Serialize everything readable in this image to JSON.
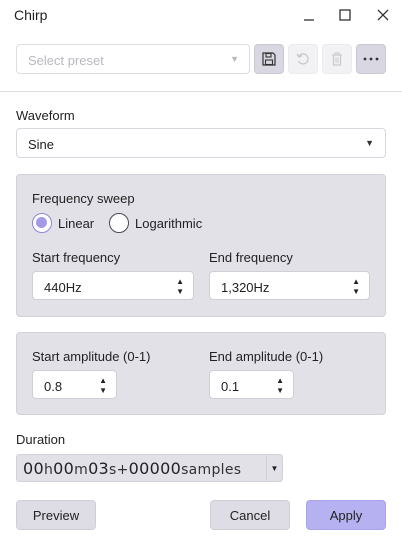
{
  "window": {
    "title": "Chirp"
  },
  "preset": {
    "placeholder": "Select preset"
  },
  "waveform": {
    "label": "Waveform",
    "value": "Sine"
  },
  "sweep": {
    "label": "Frequency sweep",
    "options": [
      "Linear",
      "Logarithmic"
    ],
    "selected": "Linear",
    "start_label": "Start frequency",
    "start_value": "440Hz",
    "end_label": "End frequency",
    "end_value": "1,320Hz"
  },
  "amplitude": {
    "start_label": "Start amplitude (0-1)",
    "start_value": "0.8",
    "end_label": "End amplitude (0-1)",
    "end_value": "0.1"
  },
  "duration": {
    "label": "Duration",
    "hours": "00",
    "hours_unit": "h",
    "minutes": "00",
    "minutes_unit": "m",
    "seconds": "03",
    "seconds_unit": "s+",
    "samples": "00000",
    "samples_unit": "samples"
  },
  "buttons": {
    "preview": "Preview",
    "cancel": "Cancel",
    "apply": "Apply"
  },
  "colors": {
    "accent": "#b6b1f0",
    "panel": "#e2e1e8"
  },
  "icons": {
    "minimize": "minimize-icon",
    "maximize": "maximize-icon",
    "close": "close-icon",
    "save": "save-icon",
    "undo": "undo-icon",
    "delete": "trash-icon",
    "more": "more-icon"
  }
}
